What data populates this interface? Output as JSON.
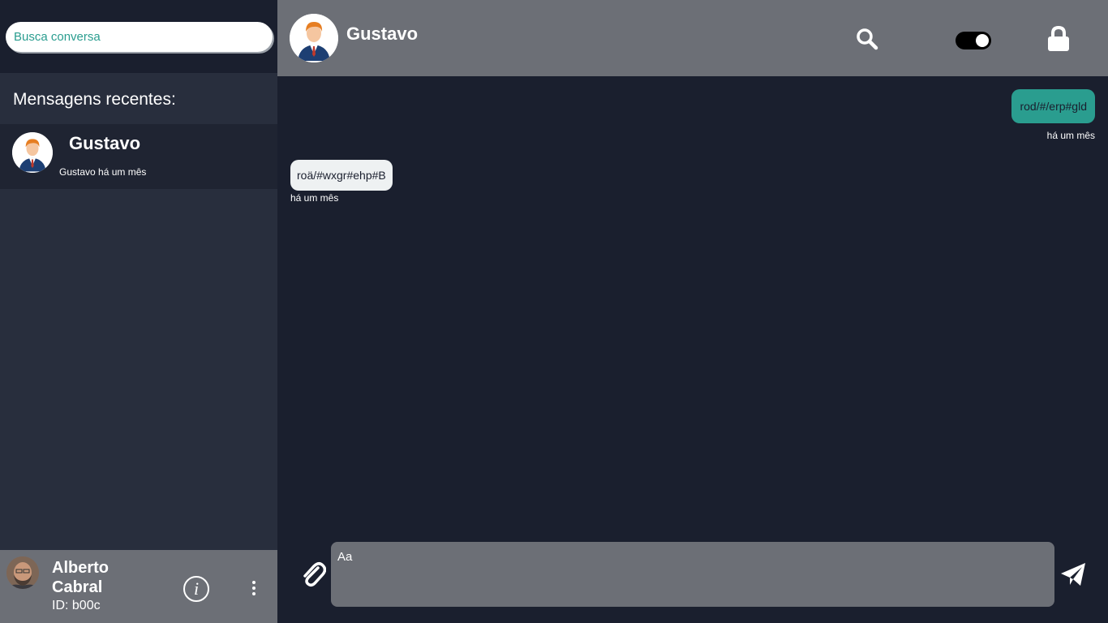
{
  "sidebar": {
    "search_placeholder": "Busca conversa",
    "recent_title": "Mensagens recentes:",
    "conversations": [
      {
        "name": "Gustavo",
        "preview": "Gustavo há um mês"
      }
    ],
    "user": {
      "name": "Alberto Cabral",
      "id": "ID: b00c"
    },
    "info_icon": "info-icon",
    "more_icon": "more-vertical-icon"
  },
  "chat": {
    "contact_name": "Gustavo",
    "header_icons": [
      "search-icon",
      "toggle-switch",
      "lock-icon"
    ],
    "toggle_on": true,
    "messages": [
      {
        "direction": "out",
        "text": "rod/#/erp#gld",
        "time": "há um mês"
      },
      {
        "direction": "in",
        "text": "roä/#wxgr#ehp#B",
        "time": "há um mês"
      }
    ],
    "input_placeholder": "Aa",
    "attach_icon": "paperclip-icon",
    "send_icon": "send-icon"
  },
  "colors": {
    "background": "#1a1f2e",
    "sidebar": "#282e3d",
    "header": "#6c6f76",
    "accent": "#2a9d8f"
  }
}
